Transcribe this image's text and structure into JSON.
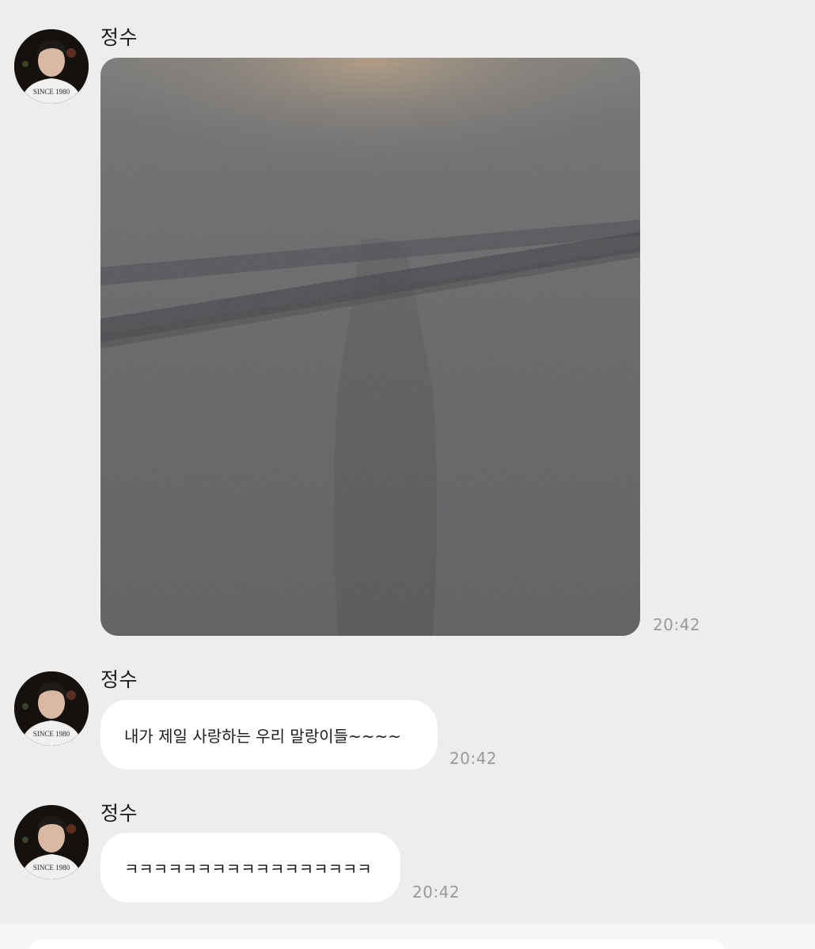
{
  "messages": [
    {
      "sender": "정수",
      "type": "image",
      "time": "20:42",
      "avatar_icon": "profile-photo"
    },
    {
      "sender": "정수",
      "type": "text",
      "text": "내가 제일 사랑하는 우리 말랑이들~~~~",
      "time": "20:42",
      "avatar_icon": "profile-photo"
    },
    {
      "sender": "정수",
      "type": "text",
      "text": "ㅋㅋㅋㅋㅋㅋㅋㅋㅋㅋㅋㅋㅋㅋㅋㅋㅋ",
      "time": "20:42",
      "avatar_icon": "profile-photo"
    }
  ],
  "colors": {
    "background": "#ededed",
    "bubble": "#ffffff",
    "timestamp": "#9a9a9a",
    "asphalt": "#5c5e61"
  }
}
